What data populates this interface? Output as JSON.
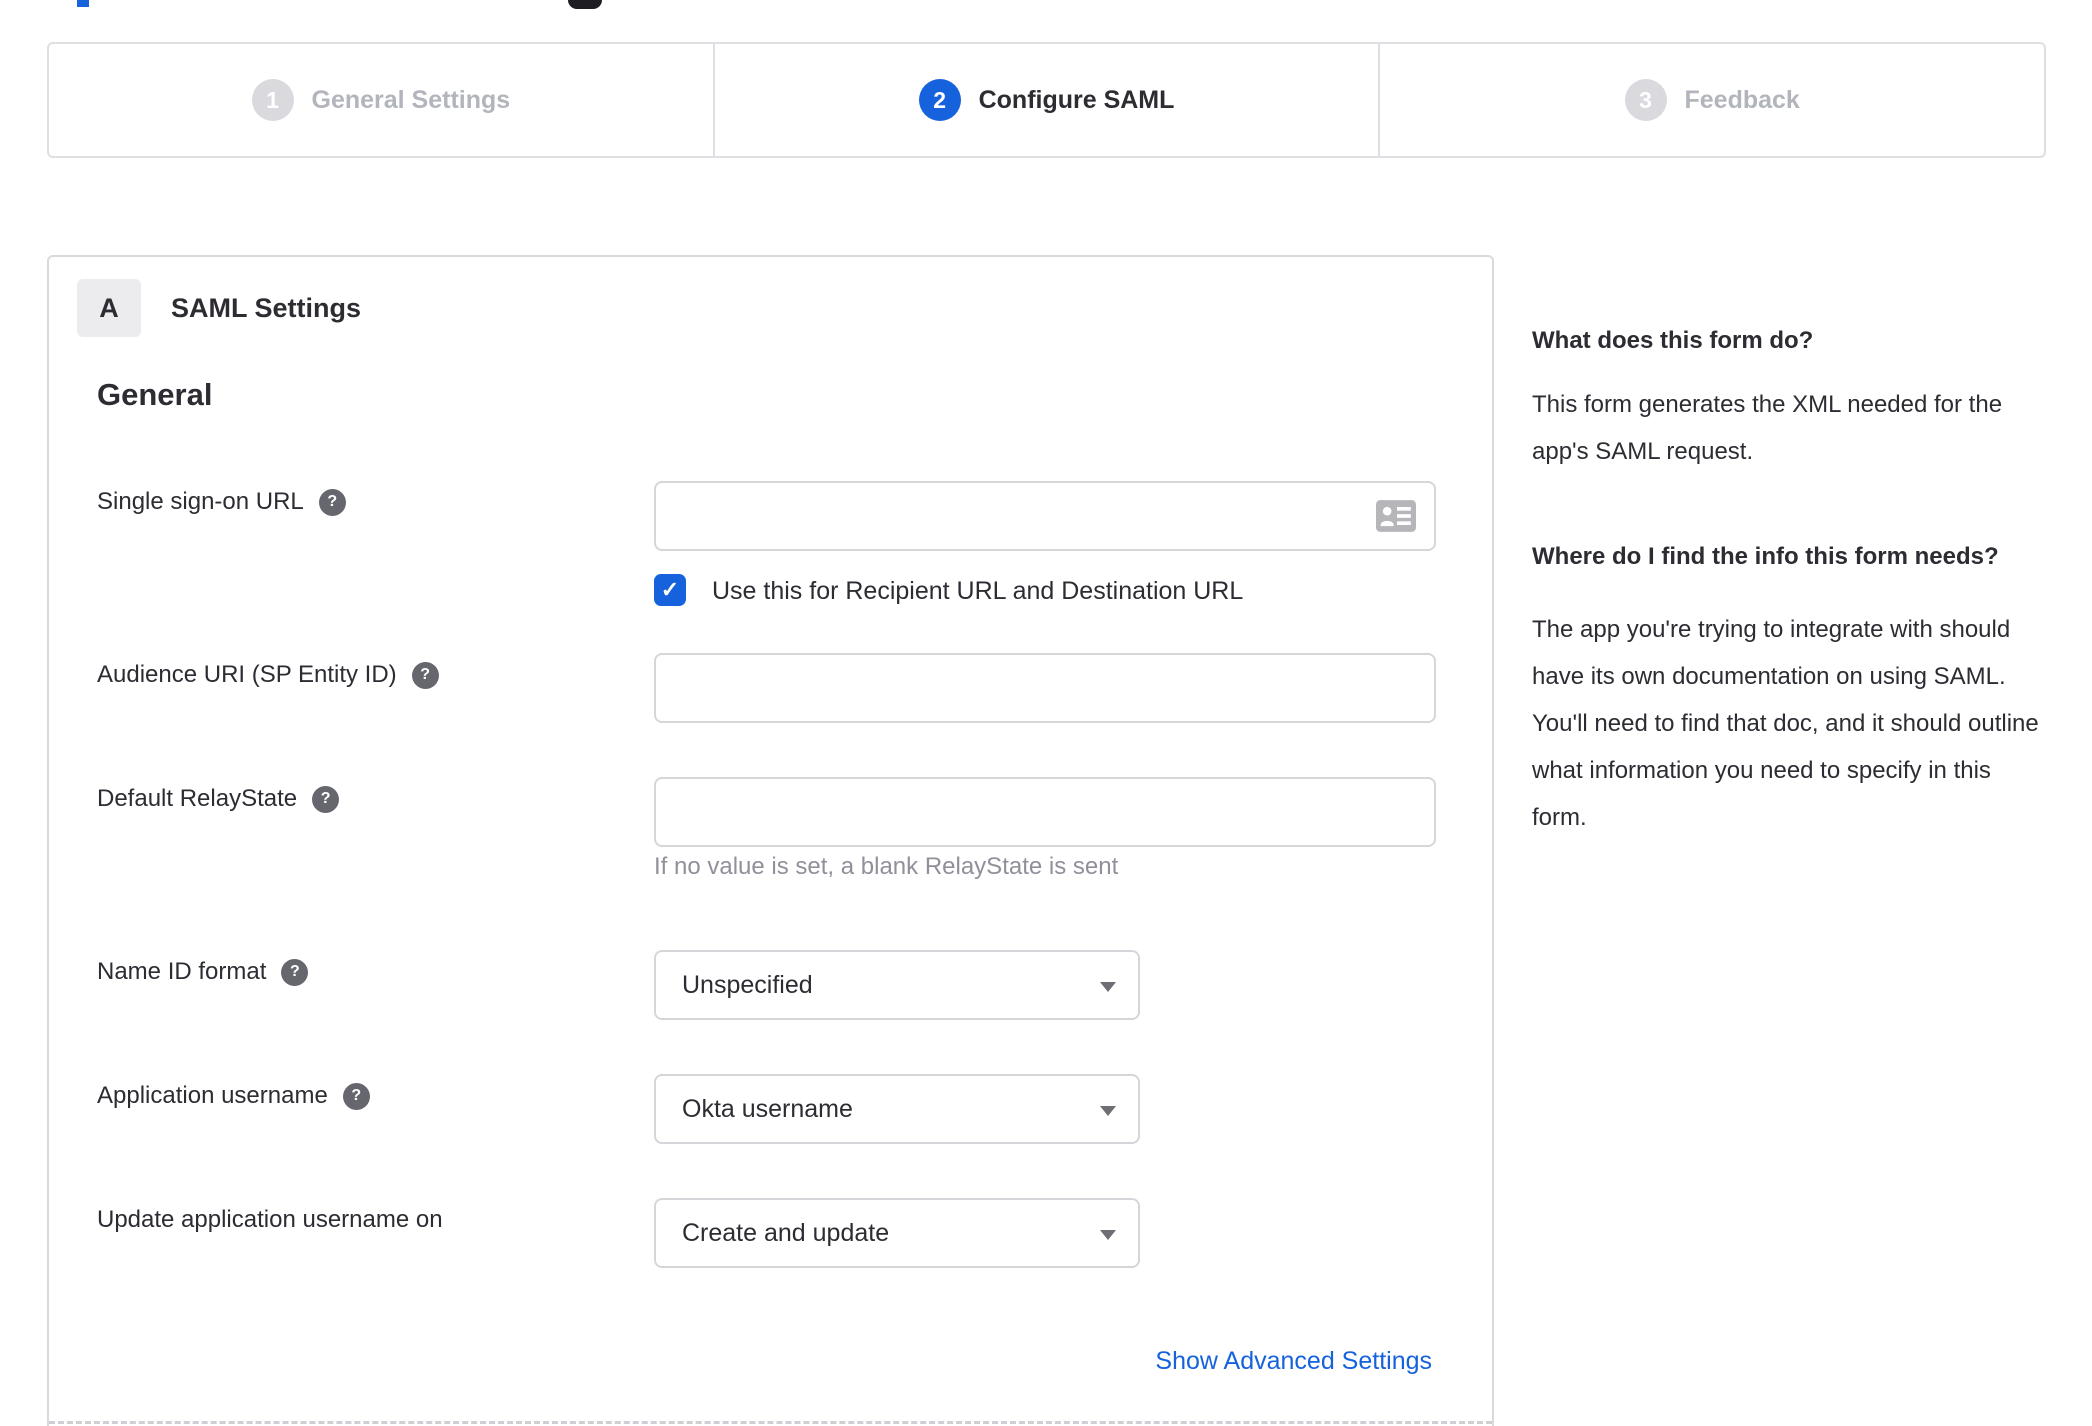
{
  "colors": {
    "accent_blue": "#1662dd",
    "inactive_gray": "#d9d9de",
    "border_gray": "#dadade",
    "helper_text_gray": "#90909a",
    "text_dark": "#2c2c33"
  },
  "stepper": {
    "steps": [
      {
        "number": "1",
        "label": "General Settings",
        "state": "inactive"
      },
      {
        "number": "2",
        "label": "Configure SAML",
        "state": "active"
      },
      {
        "number": "3",
        "label": "Feedback",
        "state": "inactive"
      }
    ]
  },
  "panel": {
    "badge": "A",
    "title": "SAML Settings",
    "section_heading": "General",
    "fields": {
      "sso_url": {
        "label": "Single sign-on URL",
        "value": "",
        "checkbox_label": "Use this for Recipient URL and Destination URL",
        "checkbox_checked": true
      },
      "audience_uri": {
        "label": "Audience URI (SP Entity ID)",
        "value": ""
      },
      "default_relay_state": {
        "label": "Default RelayState",
        "value": "",
        "helper": "If no value is set, a blank RelayState is sent"
      },
      "name_id_format": {
        "label": "Name ID format",
        "value": "Unspecified"
      },
      "application_username": {
        "label": "Application username",
        "value": "Okta username"
      },
      "update_app_username_on": {
        "label": "Update application username on",
        "value": "Create and update"
      }
    },
    "advanced_link": "Show Advanced Settings"
  },
  "help_panel": {
    "heading1": "What does this form do?",
    "body1": "This form generates the XML needed for the app's SAML request.",
    "heading2": "Where do I find the info this form needs?",
    "body2": "The app you're trying to integrate with should have its own documentation on using SAML. You'll need to find that doc, and it should outline what information you need to specify in this form."
  },
  "icons": {
    "help_glyph": "?",
    "check_glyph": "✓"
  }
}
